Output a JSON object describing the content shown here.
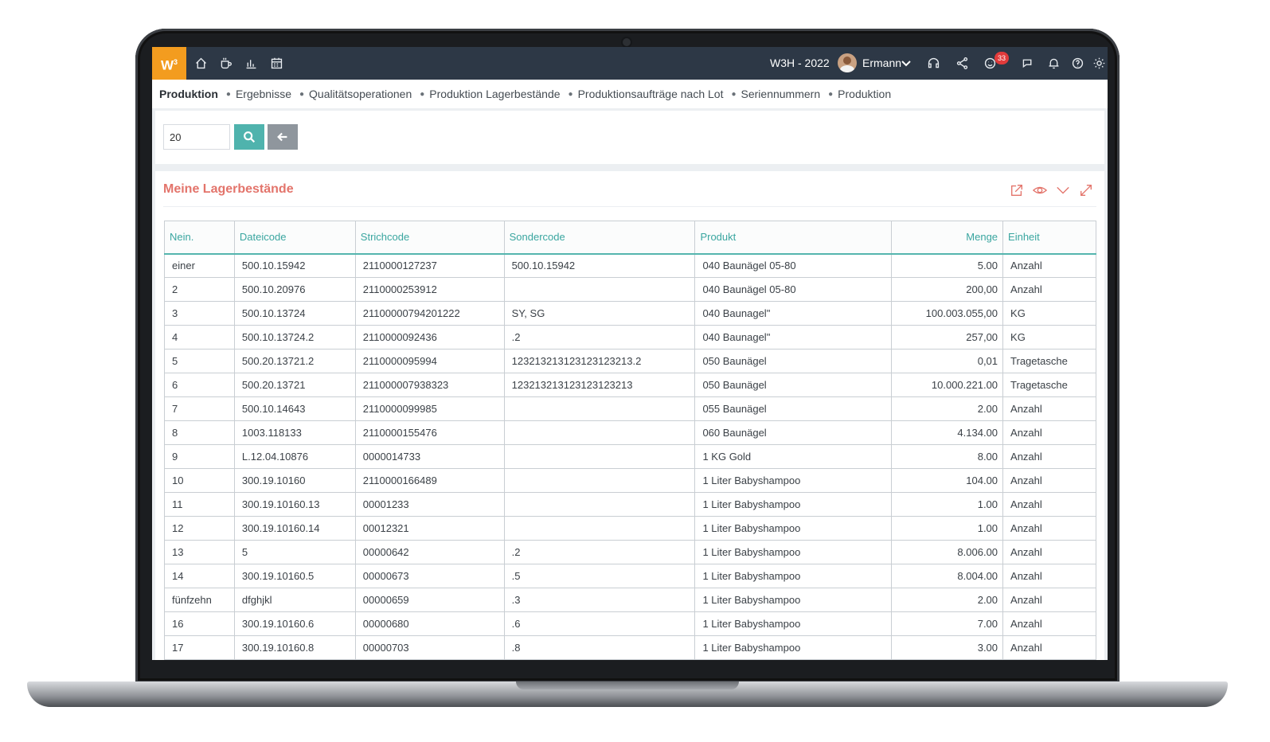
{
  "header": {
    "logo_text": "W",
    "logo_sup": "3",
    "company": "W3H - 2022",
    "user": "Ermann",
    "notification_count": "33",
    "icons": [
      "home-icon",
      "coffee-icon",
      "chart-icon",
      "calendar-icon",
      "headset-icon",
      "share-icon",
      "smiley-icon",
      "chat-icon",
      "bell-icon",
      "help-icon",
      "gear-icon"
    ],
    "accent_color": "#f39c1f",
    "bar_color": "#2d3846"
  },
  "breadcrumb": [
    "Produktion",
    "Ergebnisse",
    "Qualitätsoperationen",
    "Produktion Lagerbestände",
    "Produktionsaufträge nach Lot",
    "Seriennummern",
    "Produktion"
  ],
  "search": {
    "value": "20"
  },
  "card": {
    "title": "Meine Lagerbestände",
    "title_color": "#e3746b",
    "action_icons": [
      "export-icon",
      "eye-icon",
      "chevron-down-icon",
      "expand-icon"
    ]
  },
  "table": {
    "headers": [
      "Nein.",
      "Dateicode",
      "Strichcode",
      "Sondercode",
      "Produkt",
      "Menge",
      "Einheit"
    ],
    "rows": [
      [
        "einer",
        "500.10.15942",
        "2110000127237",
        "500.10.15942",
        "040 Baunägel 05-80",
        "5.00",
        "Anzahl"
      ],
      [
        "2",
        "500.10.20976",
        "2110000253912",
        "",
        "040 Baunägel 05-80",
        "200,00",
        "Anzahl"
      ],
      [
        "3",
        "500.10.13724",
        "21100000794201222",
        "SY, SG",
        "040 Baunagel\"",
        "100.003.055,00",
        "KG"
      ],
      [
        "4",
        "500.10.13724.2",
        "2110000092436",
        ".2",
        "040 Baunagel\"",
        "257,00",
        "KG"
      ],
      [
        "5",
        "500.20.13721.2",
        "2110000095994",
        "123213213123123123213.2",
        "050 Baunägel",
        "0,01",
        "Tragetasche"
      ],
      [
        "6",
        "500.20.13721",
        "211000007938323",
        "123213213123123123213",
        "050 Baunägel",
        "10.000.221.00",
        "Tragetasche"
      ],
      [
        "7",
        "500.10.14643",
        "2110000099985",
        "",
        "055 Baunägel",
        "2.00",
        "Anzahl"
      ],
      [
        "8",
        "1003.118133",
        "2110000155476",
        "",
        "060 Baunägel",
        "4.134.00",
        "Anzahl"
      ],
      [
        "9",
        "L.12.04.10876",
        "0000014733",
        "",
        "1 KG Gold",
        "8.00",
        "Anzahl"
      ],
      [
        "10",
        "300.19.10160",
        "2110000166489",
        "",
        "1 Liter Babyshampoo",
        "104.00",
        "Anzahl"
      ],
      [
        "11",
        "300.19.10160.13",
        "00001233",
        "",
        "1 Liter Babyshampoo",
        "1.00",
        "Anzahl"
      ],
      [
        "12",
        "300.19.10160.14",
        "00012321",
        "",
        "1 Liter Babyshampoo",
        "1.00",
        "Anzahl"
      ],
      [
        "13",
        "5",
        "00000642",
        ".2",
        "1 Liter Babyshampoo",
        "8.006.00",
        "Anzahl"
      ],
      [
        "14",
        "300.19.10160.5",
        "00000673",
        ".5",
        "1 Liter Babyshampoo",
        "8.004.00",
        "Anzahl"
      ],
      [
        "fünfzehn",
        "dfghjkl",
        "00000659",
        ".3",
        "1 Liter Babyshampoo",
        "2.00",
        "Anzahl"
      ],
      [
        "16",
        "300.19.10160.6",
        "00000680",
        ".6",
        "1 Liter Babyshampoo",
        "7.00",
        "Anzahl"
      ],
      [
        "17",
        "300.19.10160.8",
        "00000703",
        ".8",
        "1 Liter Babyshampoo",
        "3.00",
        "Anzahl"
      ]
    ]
  }
}
